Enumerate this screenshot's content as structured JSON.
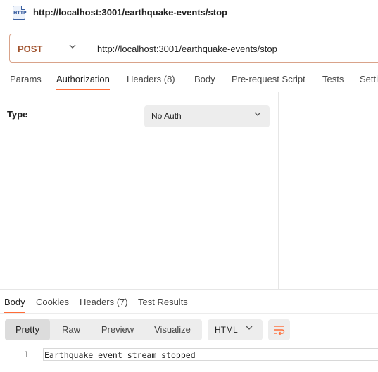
{
  "request_title": "http://localhost:3001/earthquake-events/stop",
  "icons": {
    "file": "http-file-icon",
    "http_badge": "HTTP"
  },
  "request": {
    "method": "POST",
    "url": "http://localhost:3001/earthquake-events/stop"
  },
  "request_tabs": [
    {
      "label": "Params"
    },
    {
      "label": "Authorization",
      "active": true
    },
    {
      "label": "Headers (8)"
    },
    {
      "label": "Body"
    },
    {
      "label": "Pre-request Script"
    },
    {
      "label": "Tests"
    },
    {
      "label": "Setti"
    }
  ],
  "auth": {
    "type_label": "Type",
    "selected": "No Auth"
  },
  "response_tabs": [
    {
      "label": "Body",
      "active": true
    },
    {
      "label": "Cookies"
    },
    {
      "label": "Headers (7)"
    },
    {
      "label": "Test Results"
    }
  ],
  "view_modes": [
    {
      "label": "Pretty",
      "active": true
    },
    {
      "label": "Raw"
    },
    {
      "label": "Preview"
    },
    {
      "label": "Visualize"
    }
  ],
  "format": "HTML",
  "response_body": {
    "line_number": "1",
    "text": "Earthquake event stream stopped"
  },
  "colors": {
    "accent": "#ff6c37",
    "method": "#a0522d",
    "url_border": "#d9a38a"
  }
}
